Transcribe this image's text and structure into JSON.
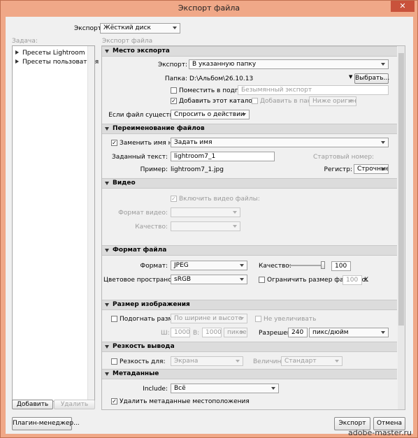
{
  "window": {
    "title": "Экспорт файла",
    "close": "✕"
  },
  "top": {
    "export_label": "Экспорт:",
    "export_value": "Жёсткий диск"
  },
  "left": {
    "header": "Задача:",
    "items": [
      "Пресеты Lightroom",
      "Пресеты пользователя"
    ],
    "add": "Добавить",
    "remove": "Удалить"
  },
  "right": {
    "header": "Экспорт файла"
  },
  "location": {
    "title": "Место экспорта",
    "export_label": "Экспорт:",
    "export_value": "В указанную папку",
    "folder_label": "Папка:",
    "folder_value": "D:\\Альбом\\26.10.13",
    "choose": "Выбрать...",
    "subfolder_label": "Поместить в подпапку:",
    "subfolder_value": "Безымянный экспорт",
    "add_catalog": "Добавить этот каталог",
    "add_stack": "Добавить в пакет:",
    "stack_value": "Ниже оригинала",
    "exists_label": "Если файл существует:",
    "exists_value": "Спросить о действии"
  },
  "rename": {
    "title": "Переименование файлов",
    "rename_label": "Заменить имя на:",
    "rename_value": "Задать имя",
    "custom_label": "Заданный текст:",
    "custom_value": "lightroom7_1",
    "start_label": "Стартовый номер:",
    "example_label": "Пример:",
    "example_value": "lightroom7_1.jpg",
    "case_label": "Регистр:",
    "case_value": "Строчные"
  },
  "video": {
    "title": "Видео",
    "include": "Включить видео файлы:",
    "format_label": "Формат видео:",
    "quality_label": "Качество:"
  },
  "fileformat": {
    "title": "Формат файла",
    "format_label": "Формат:",
    "format_value": "JPEG",
    "quality_label": "Качество:",
    "quality_value": "100",
    "quality_level": 1.0,
    "colorspace_label": "Цветовое пространство:",
    "colorspace_value": "sRGB",
    "limit_label": "Ограничить размер файла до:",
    "limit_value": "100",
    "limit_unit": "K"
  },
  "imagesize": {
    "title": "Размер изображения",
    "resize_label": "Подогнать размер",
    "resize_value": "По ширине и высоте",
    "no_enlarge": "Не увеличивать",
    "w_label": "Ш:",
    "w_value": "1000",
    "h_label": "В:",
    "h_value": "1000",
    "unit_value": "пиксел",
    "res_label": "Разрешение:",
    "res_value": "240",
    "res_unit": "пикс/дюйм"
  },
  "sharpen": {
    "title": "Резкость вывода",
    "for_label": "Резкость для:",
    "for_value": "Экрана",
    "amount_label": "Величина:",
    "amount_value": "Стандарт"
  },
  "metadata": {
    "title": "Метаданные",
    "include_label": "Include:",
    "include_value": "Всё",
    "remove_location": "Удалить метаданные местоположения"
  },
  "bottom": {
    "plugin": "Плагин-менеджер...",
    "export": "Экспорт",
    "cancel": "Отмена"
  },
  "watermark": "adobe-master.ru"
}
